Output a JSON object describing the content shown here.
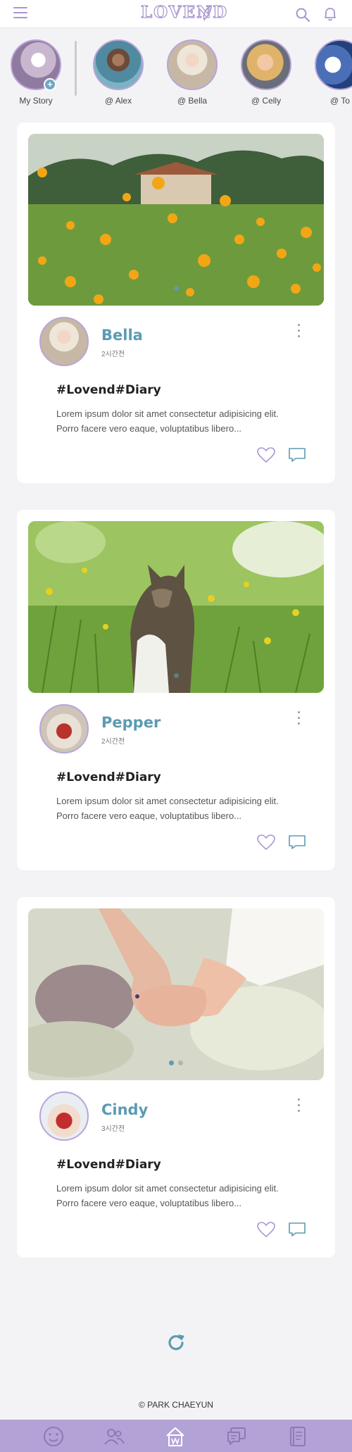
{
  "header": {
    "logo_text": "LOVEND",
    "icons": [
      "menu-icon",
      "leaf-icon",
      "search-icon",
      "bell-icon"
    ]
  },
  "stories": [
    {
      "label": "My Story",
      "add_badge": "+"
    },
    {
      "label": "@ Alex"
    },
    {
      "label": "@ Bella"
    },
    {
      "label": "@ Celly"
    },
    {
      "label": "@ To"
    }
  ],
  "posts": [
    {
      "author": "Bella",
      "time": "2시간전",
      "title": "#Lovend#Diary",
      "text": "Lorem ipsum dolor sit amet consectetur adipisicing elit. Porro facere vero eaque, voluptatibus libero...",
      "photo": "poppy-field"
    },
    {
      "author": "Pepper",
      "time": "2시간전",
      "title": "#Lovend#Diary",
      "text": "Lorem ipsum dolor sit amet consectetur adipisicing elit. Porro facere vero eaque, voluptatibus libero...",
      "photo": "cat-in-grass"
    },
    {
      "author": "Cindy",
      "time": "3시간전",
      "title": "#Lovend#Diary",
      "text": "Lorem ipsum dolor sit amet consectetur adipisicing elit. Porro facere vero eaque, voluptatibus libero...",
      "photo": "holding-hands",
      "slide_dots": 2
    }
  ],
  "footer": {
    "copyright": "© PARK CHAEYUN"
  },
  "bottom_nav": [
    "face-icon",
    "friends-icon",
    "home-icon",
    "messages-icon",
    "diary-icon"
  ],
  "colors": {
    "accent_purple": "#a995cf",
    "accent_teal": "#5b9bb3",
    "nav_bg": "#b3a2d6"
  }
}
